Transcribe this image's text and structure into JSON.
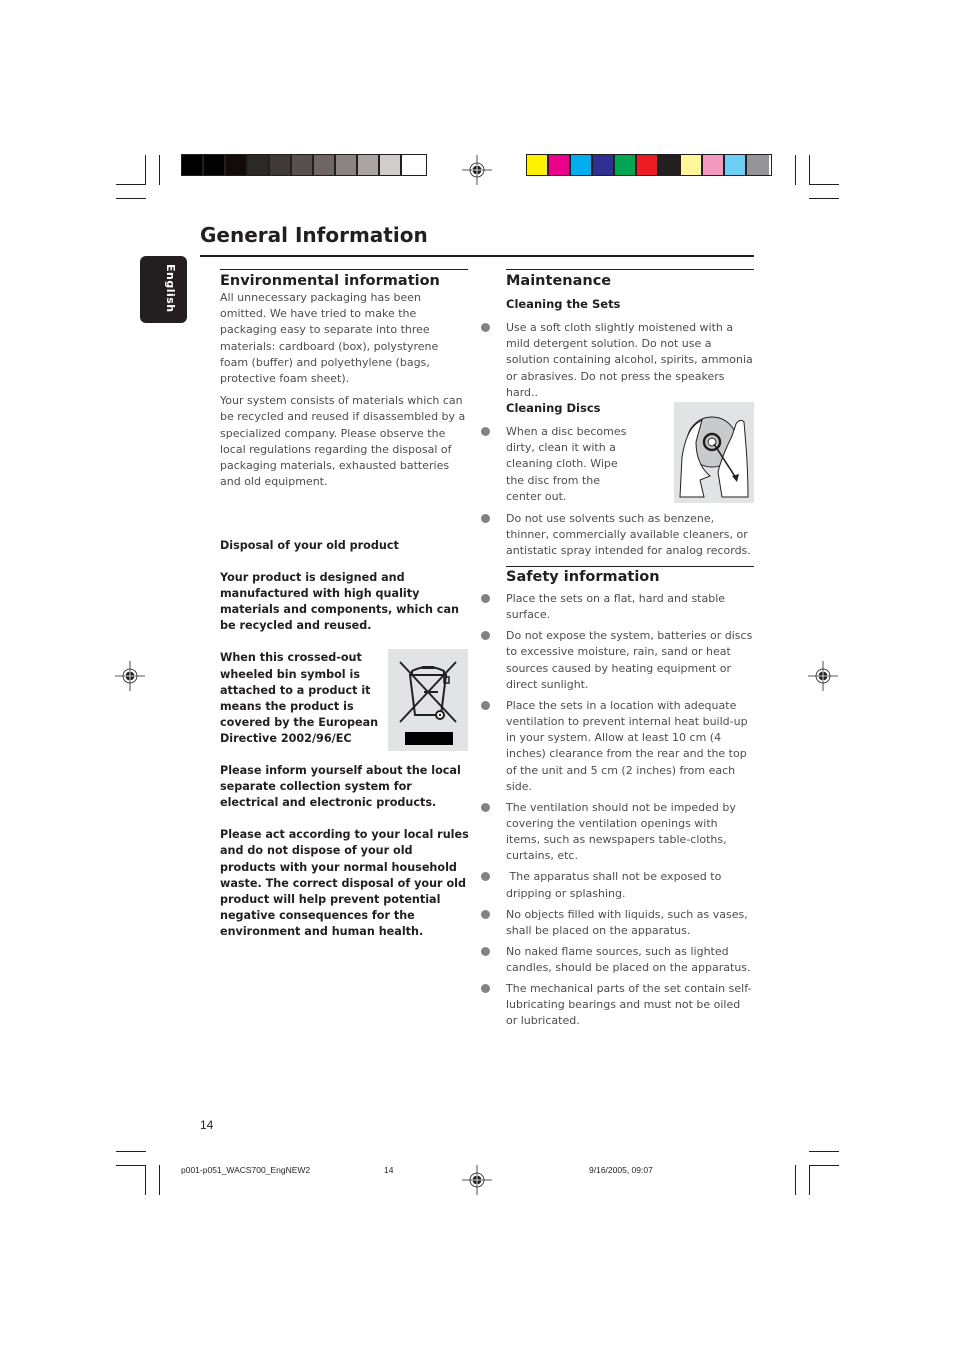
{
  "print_marks": {
    "grayscale_swatches": [
      "#000000",
      "#030303",
      "#130b08",
      "#2b2826",
      "#3f3a37",
      "#58504e",
      "#6f6563",
      "#8c8482",
      "#aaa5a3",
      "#d0cdcc",
      "#ffffff"
    ],
    "color_swatches": [
      "#fff200",
      "#ec008c",
      "#00aeef",
      "#2e3192",
      "#00a651",
      "#ed1c24",
      "#231f20",
      "#fff799",
      "#f49ac1",
      "#6dcff6",
      "#939598"
    ]
  },
  "page": {
    "title": "General Information",
    "language_tab": "English",
    "page_number": "14"
  },
  "environmental": {
    "heading": "Environmental information",
    "paragraphs": [
      "All unnecessary packaging has been omitted. We have tried to make the packaging easy to separate into three materials: cardboard (box), polystyrene foam (buffer) and polyethylene (bags, protective foam sheet).",
      "Your system consists of materials which can be recycled and reused if disassembled by a specialized company. Please observe the local regulations regarding the disposal of packaging materials, exhausted batteries and old equipment."
    ]
  },
  "disposal": {
    "heading": "Disposal of  your old product",
    "paragraphs": [
      "Your product is designed and manufactured with high quality materials and components, which can be recycled and reused.",
      "When this crossed-out wheeled bin symbol is attached to a product it means the product is covered by the European Directive 2002/96/EC",
      "Please inform yourself about the local separate collection system for electrical and electronic products.",
      "Please act according to your local rules and do not dispose of your old products with your normal household waste. The correct disposal of your old product will help prevent potential negative consequences for the environment and human health."
    ],
    "image": "crossed-out-wheeled-bin"
  },
  "maintenance": {
    "heading": "Maintenance",
    "cleaning_sets": {
      "heading": "Cleaning the Sets",
      "bullets": [
        "Use a soft cloth slightly moistened with a mild detergent solution. Do not use a solution containing alcohol, spirits, ammonia or abrasives. Do not press the speakers hard.."
      ]
    },
    "cleaning_discs": {
      "heading": "Cleaning Discs",
      "bullets": [
        "When a disc becomes dirty, clean it with a cleaning cloth. Wipe the disc from the center out.",
        "Do not use solvents such as benzene, thinner, commercially available cleaners, or antistatic spray intended for analog records."
      ],
      "image": "hands-cleaning-disc"
    }
  },
  "safety": {
    "heading": "Safety information",
    "bullets": [
      "Place the sets on a flat, hard and stable surface.",
      "Do not expose the system, batteries or discs to excessive moisture, rain, sand or heat sources caused by heating equipment or direct sunlight.",
      "Place the sets in a location with adequate ventilation to prevent internal heat build-up in your system.  Allow at least 10 cm (4 inches) clearance from the rear and the top of the unit and 5 cm (2 inches) from each side.",
      "The ventilation should not be impeded by covering the ventilation openings with items, such as newspapers table-cloths, curtains, etc.",
      " The apparatus shall not be exposed to dripping or splashing.",
      "No objects filled with liquids, such as vases, shall be placed on the apparatus.",
      "No naked flame sources, such as lighted candles, should be placed on the apparatus.",
      "The mechanical parts of the set contain self-lubricating bearings and must not be oiled or lubricated."
    ]
  },
  "footer": {
    "file_name": "p001-p051_WACS700_EngNEW2",
    "page": "14",
    "timestamp": "9/16/2005, 09:07"
  }
}
